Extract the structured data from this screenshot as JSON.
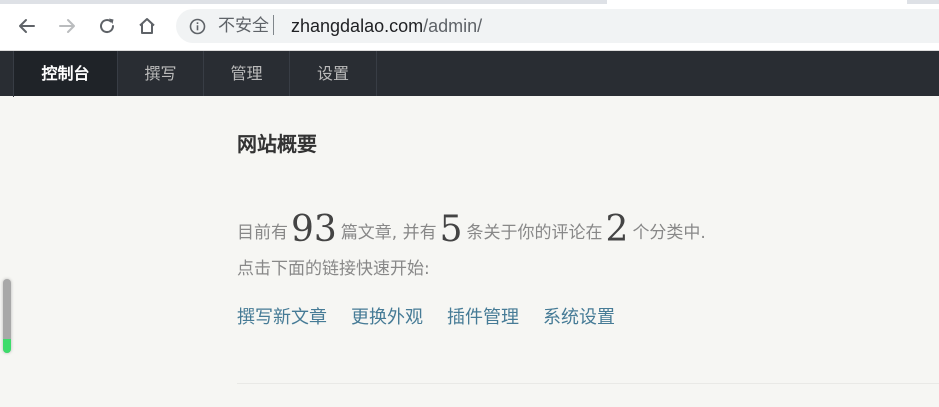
{
  "browser": {
    "security_label": "不安全",
    "url_host": "zhangdalao.com",
    "url_path": "/admin/",
    "icons": [
      "back-icon",
      "forward-icon",
      "reload-icon",
      "home-icon",
      "info-icon"
    ]
  },
  "nav": {
    "items": [
      {
        "label": "控制台",
        "active": true
      },
      {
        "label": "撰写",
        "active": false
      },
      {
        "label": "管理",
        "active": false
      },
      {
        "label": "设置",
        "active": false
      }
    ]
  },
  "main": {
    "title": "网站概要",
    "stats": {
      "prefix": "目前有",
      "posts": "93",
      "posts_suffix": "篇文章, 并有",
      "comments": "5",
      "comments_suffix": "条关于你的评论在",
      "categories": "2",
      "categories_suffix": "个分类中."
    },
    "quick_start": "点击下面的链接快速开始:",
    "links": [
      "撰写新文章",
      "更换外观",
      "插件管理",
      "系统设置"
    ]
  },
  "scroll_indicator": {
    "level_fraction": 0.19
  },
  "colors": {
    "nav_bg": "#292d33",
    "nav_active_bg": "#1f2328",
    "page_bg": "#f6f6f3",
    "link": "#467b96",
    "indicator": "#3ddc6b"
  }
}
